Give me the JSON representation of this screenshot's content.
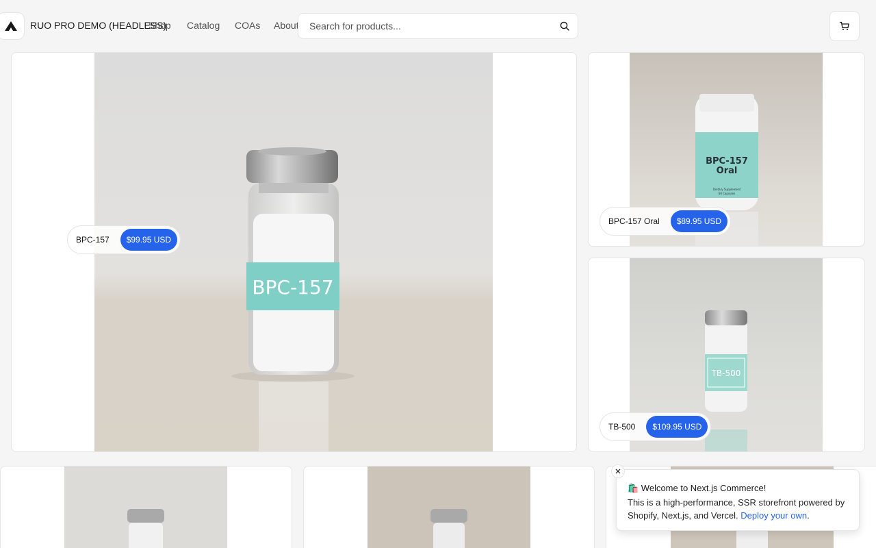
{
  "header": {
    "brand": "RUO PRO DEMO (HEADLESS)",
    "nav": [
      "Shop",
      "Catalog",
      "COAs",
      "About"
    ],
    "search_placeholder": "Search for products..."
  },
  "products": [
    {
      "name": "BPC-157",
      "price": "$99.95 USD",
      "vial_label": "BPC-157"
    },
    {
      "name": "BPC-157 Oral",
      "price": "$89.95 USD",
      "bottle_label_line1": "BPC-157",
      "bottle_label_line2": "Oral",
      "bottle_small_1": "Dietary Supplement",
      "bottle_small_2": "60 Capsules"
    },
    {
      "name": "TB-500",
      "price": "$109.95 USD",
      "vial_label": "TB-500"
    }
  ],
  "toast": {
    "title": "🛍️ Welcome to Next.js Commerce!",
    "body": "This is a high-performance, SSR storefront powered by Shopify, Next.js, and Vercel.",
    "link": "Deploy your own",
    "after_link": "."
  },
  "icons": {
    "logo": "triangle-logo-icon",
    "search": "search-icon",
    "cart": "cart-icon",
    "close": "close-icon"
  },
  "colors": {
    "accent": "#2563eb",
    "vial_label": "#7fcfc7"
  }
}
